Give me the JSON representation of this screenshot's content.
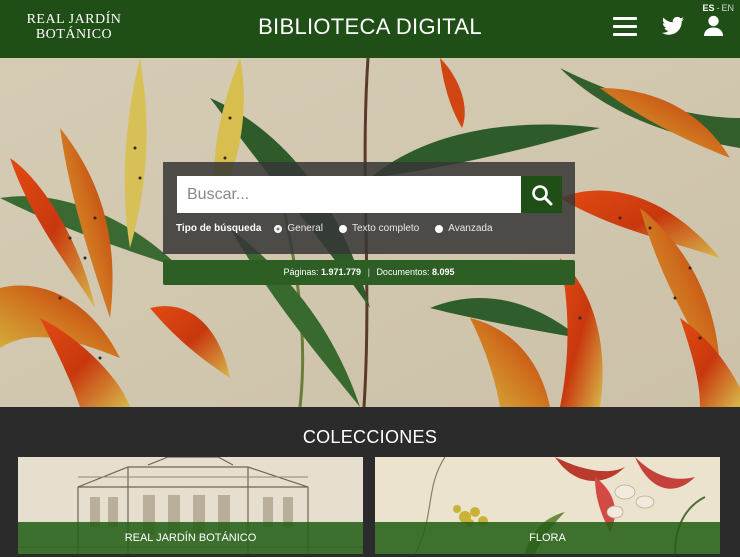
{
  "header": {
    "logo_line1": "REAL JARDÍN",
    "logo_line2": "BOTÁNICO",
    "title": "BIBLIOTECA DIGITAL",
    "lang_es": "ES",
    "lang_sep": "-",
    "lang_en": "EN",
    "icons": [
      "menu-icon",
      "twitter-icon",
      "user-icon"
    ]
  },
  "search": {
    "placeholder": "Buscar...",
    "type_label": "Tipo de búsqueda",
    "options": [
      "General",
      "Texto completo",
      "Avanzada"
    ],
    "selected": "General"
  },
  "stats": {
    "pages_label": "Páginas:",
    "pages_value": "1.971.779",
    "separator": "|",
    "docs_label": "Documentos:",
    "docs_value": "8.095"
  },
  "collections": {
    "title": "COLECCIONES",
    "items": [
      {
        "label": "REAL JARDÍN BOTÁNICO"
      },
      {
        "label": "FLORA"
      }
    ]
  },
  "colors": {
    "header_green": "#1f4f17",
    "accent_green": "#2d5f24",
    "dark_bg": "#2b2b2b"
  }
}
